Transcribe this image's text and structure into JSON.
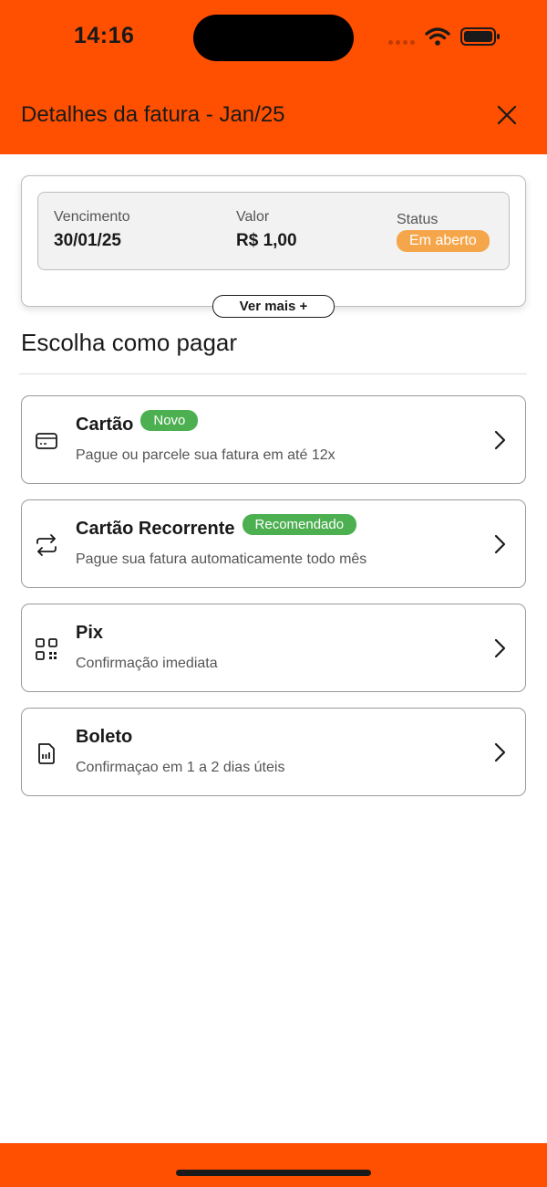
{
  "status_bar": {
    "time": "14:16"
  },
  "header": {
    "title": "Detalhes da fatura - Jan/25",
    "close_icon": "close-icon"
  },
  "summary": {
    "due_label": "Vencimento",
    "due_value": "30/01/25",
    "amount_label": "Valor",
    "amount_value": "R$ 1,00",
    "status_label": "Status",
    "status_value": "Em aberto",
    "more_button": "Ver mais +"
  },
  "section": {
    "title": "Escolha como pagar"
  },
  "options": [
    {
      "icon": "credit-card-icon",
      "title": "Cartão",
      "badge": "Novo",
      "description": "Pague ou parcele sua fatura em até 12x"
    },
    {
      "icon": "recurring-icon",
      "title": "Cartão Recorrente",
      "badge": "Recomendado",
      "description": "Pague sua fatura automaticamente todo mês"
    },
    {
      "icon": "qr-code-icon",
      "title": "Pix",
      "badge": "",
      "description": "Confirmação imediata"
    },
    {
      "icon": "barcode-document-icon",
      "title": "Boleto",
      "badge": "",
      "description": "Confirmaçao em 1 a 2 dias úteis"
    }
  ],
  "colors": {
    "brand": "#ff4f00",
    "status_badge": "#f5a64a",
    "option_badge": "#4caf50"
  }
}
